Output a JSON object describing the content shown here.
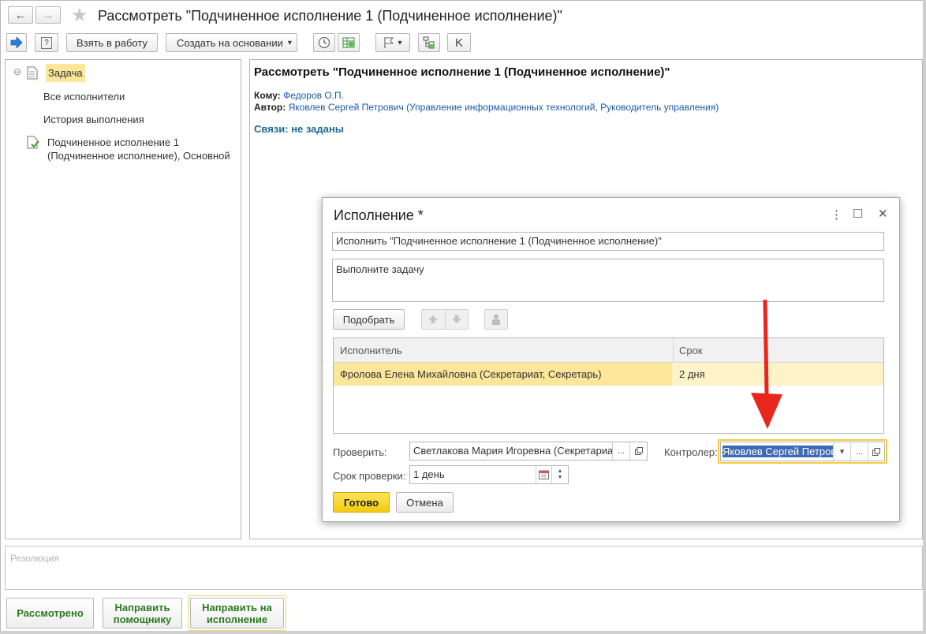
{
  "window": {
    "title": "Рассмотреть \"Подчиненное исполнение 1 (Подчиненное исполнение)\"",
    "nav_back": "←",
    "nav_forward": "→",
    "favorite_star": "★"
  },
  "toolbar": {
    "help_label": "?",
    "take_to_work": "Взять в работу",
    "create_based_on": "Создать на основании",
    "dropdown_arrow": "▾",
    "k_label": "K"
  },
  "tree": {
    "collapse_glyph": "⊖",
    "items": [
      {
        "label": "Задача"
      },
      {
        "label": "Все исполнители"
      },
      {
        "label": "История выполнения"
      },
      {
        "label_line1": "Подчиненное исполнение 1",
        "label_line2": "(Подчиненное исполнение), Основной"
      }
    ]
  },
  "main": {
    "heading": "Рассмотреть \"Подчиненное исполнение 1 (Подчиненное исполнение)\"",
    "to_label": "Кому:",
    "to_value": "Федоров О.П.",
    "author_label": "Автор:",
    "author_value": "Яковлев Сергей Петрович (Управление информационных технологий, Руководитель управления)",
    "links_text": "Связи: не заданы"
  },
  "dialog": {
    "title": "Исполнение *",
    "menu_glyph": "⋮",
    "maximize_glyph": "☐",
    "close_glyph": "✕",
    "subject": "Исполнить \"Подчиненное исполнение 1 (Подчиненное исполнение)\"",
    "description": "Выполните задачу",
    "pick_button": "Подобрать",
    "grid": {
      "col_executor": "Исполнитель",
      "col_deadline": "Срок",
      "rows": [
        {
          "executor": "Фролова Елена Михайловна (Секретариат, Секретарь)",
          "deadline": "2 дня"
        }
      ]
    },
    "check_label": "Проверить:",
    "check_value": "Светлакова Мария Игоревна (Секретариат",
    "controller_label": "Контролер:",
    "controller_value": "Яковлев Сергей Петров",
    "check_deadline_label": "Срок проверки:",
    "check_deadline_value": "1 день",
    "ellipsis": "...",
    "ok_button": "Готово",
    "cancel_button": "Отмена"
  },
  "resolution_placeholder": "Резолюция",
  "bottom_buttons": {
    "reviewed": "Рассмотрено",
    "to_assistant": "Направить помощнику",
    "to_execution": "Направить на исполнение"
  },
  "colors": {
    "accent_yellow": "#fbe69a",
    "link_blue": "#1a5aa8",
    "action_green": "#2b7a20",
    "arrow_red": "#e8261c",
    "primary_button": "#f6d317"
  }
}
